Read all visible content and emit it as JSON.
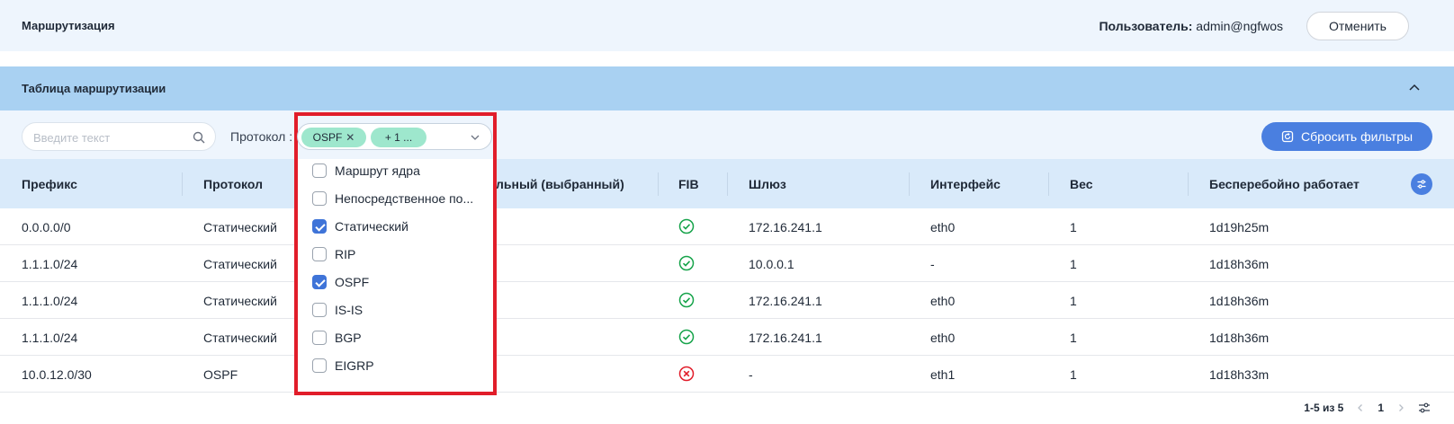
{
  "topbar": {
    "title": "Маршрутизация",
    "user_label": "Пользователь:",
    "user_value": "admin@ngfwos",
    "cancel_label": "Отменить"
  },
  "panel": {
    "title": "Таблица маршрутизации"
  },
  "filters": {
    "search_placeholder": "Введите текст",
    "protocol_label": "Протокол :",
    "selected_tag": "OSPF",
    "more_tag": "+ 1 ...",
    "reset_label": "Сбросить фильтры"
  },
  "protocol_options": [
    {
      "label": "Маршрут ядра",
      "checked": false
    },
    {
      "label": "Непосредственное по...",
      "checked": false
    },
    {
      "label": "Статический",
      "checked": true
    },
    {
      "label": "RIP",
      "checked": false
    },
    {
      "label": "OSPF",
      "checked": true
    },
    {
      "label": "IS-IS",
      "checked": false
    },
    {
      "label": "BGP",
      "checked": false
    },
    {
      "label": "EIGRP",
      "checked": false
    }
  ],
  "table": {
    "columns": [
      "Префикс",
      "Протокол",
      "льный (выбранный)",
      "FIB",
      "Шлюз",
      "Интерфейс",
      "Вес",
      "Бесперебойно работает"
    ],
    "rows": [
      {
        "prefix": "0.0.0.0/0",
        "protocol": "Статический",
        "fib": "ok",
        "gateway": "172.16.241.1",
        "iface": "eth0",
        "weight": "1",
        "uptime": "1d19h25m"
      },
      {
        "prefix": "1.1.1.0/24",
        "protocol": "Статический",
        "fib": "ok",
        "gateway": "10.0.0.1",
        "iface": "-",
        "weight": "1",
        "uptime": "1d18h36m"
      },
      {
        "prefix": "1.1.1.0/24",
        "protocol": "Статический",
        "fib": "ok",
        "gateway": "172.16.241.1",
        "iface": "eth0",
        "weight": "1",
        "uptime": "1d18h36m"
      },
      {
        "prefix": "1.1.1.0/24",
        "protocol": "Статический",
        "fib": "ok",
        "gateway": "172.16.241.1",
        "iface": "eth0",
        "weight": "1",
        "uptime": "1d18h36m"
      },
      {
        "prefix": "10.0.12.0/30",
        "protocol": "OSPF",
        "fib": "error",
        "gateway": "-",
        "iface": "eth1",
        "weight": "1",
        "uptime": "1d18h33m"
      }
    ]
  },
  "pager": {
    "count": "1-5 из 5",
    "page": "1"
  },
  "colors": {
    "accent": "#4a7fe0",
    "ok": "#16a34a",
    "error": "#e11d2a",
    "tag": "#9ee7cd",
    "highlight": "#e11d2a"
  }
}
